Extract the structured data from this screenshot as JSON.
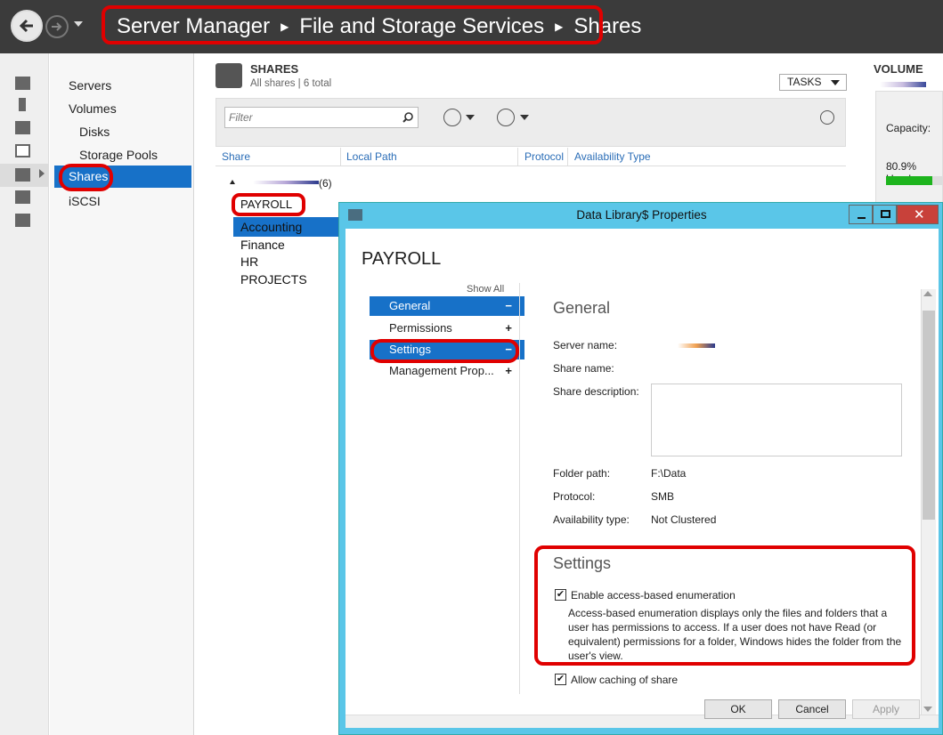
{
  "breadcrumb": [
    "Server Manager",
    "File and Storage Services",
    "Shares"
  ],
  "nav": {
    "items": [
      {
        "label": "Servers"
      },
      {
        "label": "Volumes"
      },
      {
        "label": "Disks"
      },
      {
        "label": "Storage Pools"
      },
      {
        "label": "Shares"
      },
      {
        "label": "iSCSI"
      }
    ]
  },
  "shares": {
    "title": "SHARES",
    "subtitle": "All shares | 6 total",
    "tasks_label": "TASKS",
    "filter_placeholder": "Filter",
    "columns": [
      "Share",
      "Local Path",
      "Protocol",
      "Availability Type"
    ],
    "group_count": "(6)",
    "items": [
      "PAYROLL",
      "Accounting",
      "Finance",
      "HR",
      "PROJECTS"
    ]
  },
  "volume": {
    "title": "VOLUME",
    "capacity_label": "Capacity:",
    "used_label": "80.9% Used",
    "used_fraction": 0.809
  },
  "dialog": {
    "title": "Data Library$ Properties",
    "share_name": "PAYROLL",
    "show_all": "Show All",
    "nav": [
      {
        "label": "General",
        "sign": "−"
      },
      {
        "label": "Permissions",
        "sign": "+"
      },
      {
        "label": "Settings",
        "sign": "−"
      },
      {
        "label": "Management Prop...",
        "sign": "+"
      }
    ],
    "general_header": "General",
    "fields": {
      "server_name_label": "Server name:",
      "share_name_label": "Share name:",
      "share_desc_label": "Share description:",
      "folder_path_label": "Folder path:",
      "folder_path_value": "F:\\Data",
      "protocol_label": "Protocol:",
      "protocol_value": "SMB",
      "availability_label": "Availability type:",
      "availability_value": "Not Clustered"
    },
    "settings_header": "Settings",
    "abe_label": "Enable access-based enumeration",
    "abe_desc": "Access-based enumeration displays only the files and folders that a user has permissions to access. If a user does not have Read (or equivalent) permissions for a folder, Windows hides the folder from the user's view.",
    "caching_label": "Allow caching of share",
    "buttons": {
      "ok": "OK",
      "cancel": "Cancel",
      "apply": "Apply"
    }
  }
}
